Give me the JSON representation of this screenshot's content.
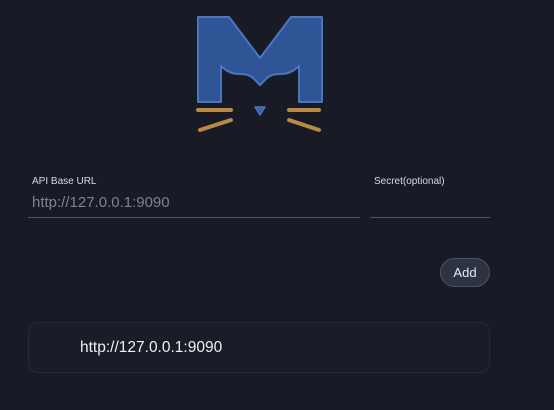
{
  "logo": {
    "icon": "meow-cat-m-logo",
    "colors": {
      "m_fill": "#2f5597",
      "m_outline": "#4a76c0",
      "whiskers": "#b88a43",
      "nose": "#3b62a8"
    }
  },
  "form": {
    "api_base_url": {
      "label": "API Base URL",
      "value": "",
      "placeholder": "http://127.0.0.1:9090"
    },
    "secret": {
      "label": "Secret(optional)",
      "value": "",
      "placeholder": ""
    },
    "add_button_label": "Add"
  },
  "backends": [
    {
      "url": "http://127.0.0.1:9090"
    }
  ],
  "colors": {
    "background": "#181b26",
    "button_bg": "#2c3443",
    "input_underline": "#4d5361"
  }
}
